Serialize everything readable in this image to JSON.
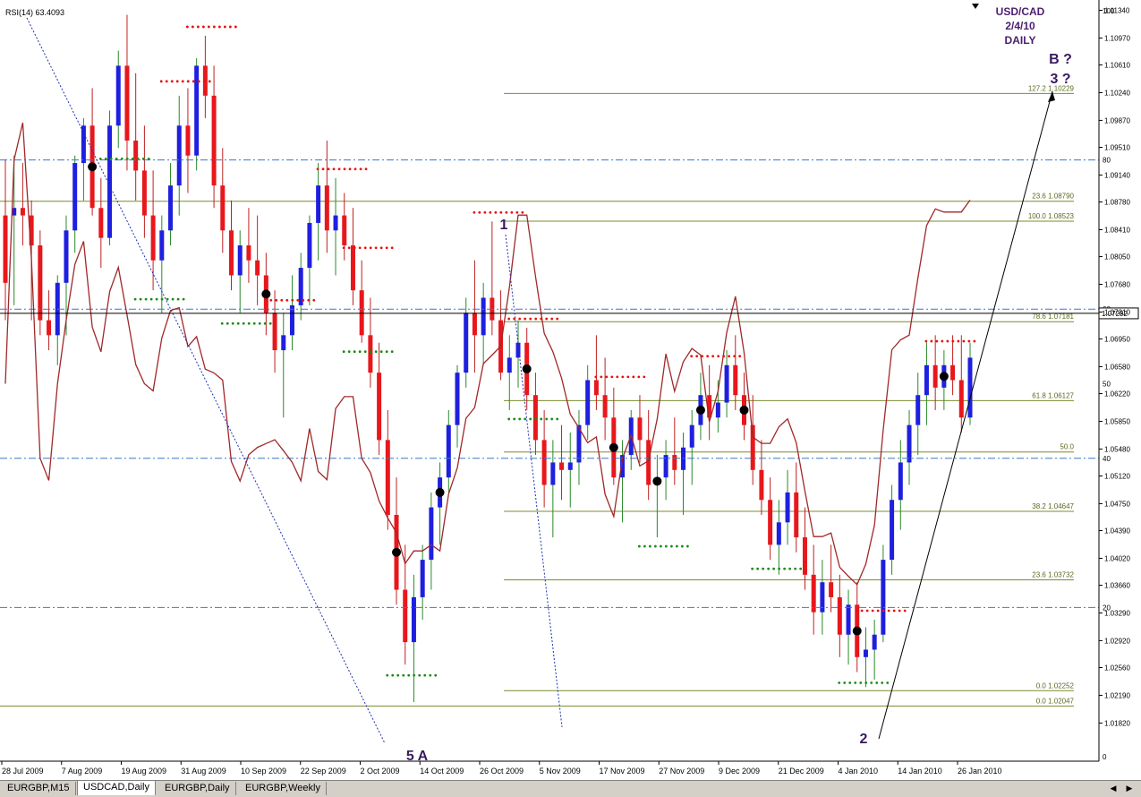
{
  "chart_data": {
    "type": "candlestick",
    "title_lines": [
      "USD/CAD",
      "2/4/10",
      "DAILY"
    ],
    "indicator_label": "RSI(14) 63.4093",
    "current_price": "1.07292",
    "ylim": [
      1.0131,
      1.1143
    ],
    "price_ticks": [
      "1.11340",
      "1.10970",
      "1.10610",
      "1.10240",
      "1.09870",
      "1.09510",
      "1.09140",
      "1.08780",
      "1.08410",
      "1.08050",
      "1.07680",
      "1.07310",
      "1.06950",
      "1.06580",
      "1.06220",
      "1.05850",
      "1.05480",
      "1.05120",
      "1.04750",
      "1.04390",
      "1.04020",
      "1.03660",
      "1.03290",
      "1.02920",
      "1.02560",
      "1.02190",
      "1.01820"
    ],
    "rsi_levels": [
      "100",
      "80",
      "60",
      "50",
      "40",
      "20",
      "0"
    ],
    "date_ticks": [
      "28 Jul 2009",
      "7 Aug 2009",
      "19 Aug 2009",
      "31 Aug 2009",
      "10 Sep 2009",
      "22 Sep 2009",
      "2 Oct 2009",
      "14 Oct 2009",
      "26 Oct 2009",
      "5 Nov 2009",
      "17 Nov 2009",
      "27 Nov 2009",
      "9 Dec 2009",
      "21 Dec 2009",
      "4 Jan 2010",
      "14 Jan 2010",
      "26 Jan 2010"
    ],
    "fib_levels": [
      {
        "label": "127.2",
        "value": "1.10229"
      },
      {
        "label": "23.6",
        "value": "1.08790"
      },
      {
        "label": "100.0",
        "value": "1.08523"
      },
      {
        "label": "78.6",
        "value": "1.07181"
      },
      {
        "label": "61.8",
        "value": "1.06127"
      },
      {
        "label": "50.0",
        "value": ""
      },
      {
        "label": "38.2",
        "value": "1.04647"
      },
      {
        "label": "23.6",
        "value": "1.03732"
      },
      {
        "label": "0.0",
        "value": "1.02252"
      },
      {
        "label": "0.0",
        "value": "1.02047"
      }
    ],
    "wave_labels": [
      "1",
      "2",
      "5 A",
      "B ?",
      "3 ?"
    ],
    "candles": [
      [
        1.086,
        1.0935,
        1.072,
        1.077
      ],
      [
        1.086,
        1.094,
        1.074,
        1.087
      ],
      [
        1.087,
        1.093,
        1.082,
        1.086
      ],
      [
        1.086,
        1.088,
        1.072,
        1.082
      ],
      [
        1.082,
        1.084,
        1.07,
        1.072
      ],
      [
        1.072,
        1.076,
        1.068,
        1.07
      ],
      [
        1.07,
        1.078,
        1.066,
        1.077
      ],
      [
        1.077,
        1.086,
        1.07,
        1.084
      ],
      [
        1.084,
        1.094,
        1.081,
        1.093
      ],
      [
        1.093,
        1.099,
        1.088,
        1.098
      ],
      [
        1.098,
        1.103,
        1.086,
        1.087
      ],
      [
        1.087,
        1.091,
        1.079,
        1.083
      ],
      [
        1.083,
        1.1,
        1.082,
        1.098
      ],
      [
        1.098,
        1.108,
        1.095,
        1.106
      ],
      [
        1.106,
        1.1128,
        1.092,
        1.096
      ],
      [
        1.096,
        1.105,
        1.088,
        1.092
      ],
      [
        1.092,
        1.098,
        1.083,
        1.086
      ],
      [
        1.086,
        1.092,
        1.076,
        1.08
      ],
      [
        1.08,
        1.086,
        1.073,
        1.084
      ],
      [
        1.084,
        1.093,
        1.082,
        1.09
      ],
      [
        1.09,
        1.102,
        1.086,
        1.098
      ],
      [
        1.098,
        1.103,
        1.089,
        1.094
      ],
      [
        1.094,
        1.107,
        1.092,
        1.106
      ],
      [
        1.106,
        1.11,
        1.099,
        1.102
      ],
      [
        1.102,
        1.106,
        1.087,
        1.09
      ],
      [
        1.09,
        1.095,
        1.081,
        1.084
      ],
      [
        1.084,
        1.088,
        1.076,
        1.078
      ],
      [
        1.078,
        1.084,
        1.073,
        1.082
      ],
      [
        1.082,
        1.087,
        1.077,
        1.08
      ],
      [
        1.08,
        1.086,
        1.074,
        1.078
      ],
      [
        1.078,
        1.081,
        1.07,
        1.073
      ],
      [
        1.073,
        1.076,
        1.065,
        1.068
      ],
      [
        1.068,
        1.073,
        1.059,
        1.07
      ],
      [
        1.07,
        1.078,
        1.068,
        1.074
      ],
      [
        1.074,
        1.081,
        1.072,
        1.079
      ],
      [
        1.079,
        1.086,
        1.074,
        1.085
      ],
      [
        1.085,
        1.093,
        1.08,
        1.09
      ],
      [
        1.09,
        1.096,
        1.081,
        1.084
      ],
      [
        1.084,
        1.091,
        1.078,
        1.086
      ],
      [
        1.086,
        1.089,
        1.08,
        1.082
      ],
      [
        1.082,
        1.087,
        1.074,
        1.076
      ],
      [
        1.076,
        1.08,
        1.069,
        1.07
      ],
      [
        1.07,
        1.075,
        1.063,
        1.065
      ],
      [
        1.065,
        1.069,
        1.054,
        1.056
      ],
      [
        1.056,
        1.06,
        1.044,
        1.046
      ],
      [
        1.046,
        1.051,
        1.034,
        1.036
      ],
      [
        1.036,
        1.042,
        1.026,
        1.029
      ],
      [
        1.029,
        1.038,
        1.021,
        1.035
      ],
      [
        1.035,
        1.042,
        1.032,
        1.04
      ],
      [
        1.04,
        1.049,
        1.036,
        1.047
      ],
      [
        1.047,
        1.053,
        1.042,
        1.051
      ],
      [
        1.051,
        1.06,
        1.049,
        1.058
      ],
      [
        1.058,
        1.066,
        1.055,
        1.065
      ],
      [
        1.065,
        1.075,
        1.063,
        1.073
      ],
      [
        1.073,
        1.08,
        1.065,
        1.07
      ],
      [
        1.07,
        1.077,
        1.066,
        1.075
      ],
      [
        1.075,
        1.0852,
        1.07,
        1.072
      ],
      [
        1.072,
        1.076,
        1.064,
        1.065
      ],
      [
        1.065,
        1.07,
        1.06,
        1.067
      ],
      [
        1.067,
        1.072,
        1.063,
        1.069
      ],
      [
        1.069,
        1.071,
        1.06,
        1.062
      ],
      [
        1.062,
        1.065,
        1.054,
        1.056
      ],
      [
        1.056,
        1.06,
        1.047,
        1.05
      ],
      [
        1.05,
        1.056,
        1.043,
        1.053
      ],
      [
        1.053,
        1.058,
        1.048,
        1.052
      ],
      [
        1.052,
        1.057,
        1.047,
        1.053
      ],
      [
        1.053,
        1.06,
        1.05,
        1.058
      ],
      [
        1.058,
        1.066,
        1.056,
        1.064
      ],
      [
        1.064,
        1.07,
        1.06,
        1.062
      ],
      [
        1.062,
        1.067,
        1.056,
        1.059
      ],
      [
        1.059,
        1.063,
        1.05,
        1.051
      ],
      [
        1.051,
        1.056,
        1.045,
        1.054
      ],
      [
        1.054,
        1.06,
        1.052,
        1.059
      ],
      [
        1.059,
        1.062,
        1.053,
        1.056
      ],
      [
        1.056,
        1.06,
        1.048,
        1.05
      ],
      [
        1.05,
        1.054,
        1.043,
        1.051
      ],
      [
        1.051,
        1.056,
        1.048,
        1.054
      ],
      [
        1.054,
        1.059,
        1.05,
        1.052
      ],
      [
        1.052,
        1.057,
        1.046,
        1.055
      ],
      [
        1.055,
        1.06,
        1.05,
        1.058
      ],
      [
        1.058,
        1.065,
        1.056,
        1.062
      ],
      [
        1.062,
        1.066,
        1.056,
        1.059
      ],
      [
        1.059,
        1.064,
        1.057,
        1.061
      ],
      [
        1.061,
        1.068,
        1.059,
        1.066
      ],
      [
        1.066,
        1.07,
        1.06,
        1.062
      ],
      [
        1.062,
        1.065,
        1.056,
        1.058
      ],
      [
        1.058,
        1.062,
        1.05,
        1.052
      ],
      [
        1.052,
        1.056,
        1.046,
        1.048
      ],
      [
        1.048,
        1.051,
        1.04,
        1.042
      ],
      [
        1.042,
        1.048,
        1.038,
        1.045
      ],
      [
        1.045,
        1.052,
        1.042,
        1.049
      ],
      [
        1.049,
        1.053,
        1.041,
        1.043
      ],
      [
        1.043,
        1.047,
        1.036,
        1.038
      ],
      [
        1.038,
        1.042,
        1.03,
        1.033
      ],
      [
        1.033,
        1.04,
        1.03,
        1.037
      ],
      [
        1.037,
        1.042,
        1.033,
        1.035
      ],
      [
        1.035,
        1.038,
        1.027,
        1.03
      ],
      [
        1.03,
        1.036,
        1.026,
        1.034
      ],
      [
        1.034,
        1.037,
        1.025,
        1.027
      ],
      [
        1.027,
        1.031,
        1.023,
        1.028
      ],
      [
        1.028,
        1.032,
        1.024,
        1.03
      ],
      [
        1.03,
        1.042,
        1.029,
        1.04
      ],
      [
        1.04,
        1.05,
        1.038,
        1.048
      ],
      [
        1.048,
        1.056,
        1.044,
        1.053
      ],
      [
        1.053,
        1.06,
        1.05,
        1.058
      ],
      [
        1.058,
        1.065,
        1.054,
        1.062
      ],
      [
        1.062,
        1.069,
        1.058,
        1.066
      ],
      [
        1.066,
        1.07,
        1.06,
        1.063
      ],
      [
        1.063,
        1.068,
        1.06,
        1.066
      ],
      [
        1.066,
        1.07,
        1.062,
        1.064
      ],
      [
        1.064,
        1.07,
        1.057,
        1.059
      ],
      [
        1.059,
        1.069,
        1.058,
        1.067
      ]
    ]
  },
  "tabs": [
    "EURGBP,M15",
    "USDCAD,Daily",
    "EURGBP,Daily",
    "EURGBP,Weekly"
  ],
  "active_tab": 1
}
